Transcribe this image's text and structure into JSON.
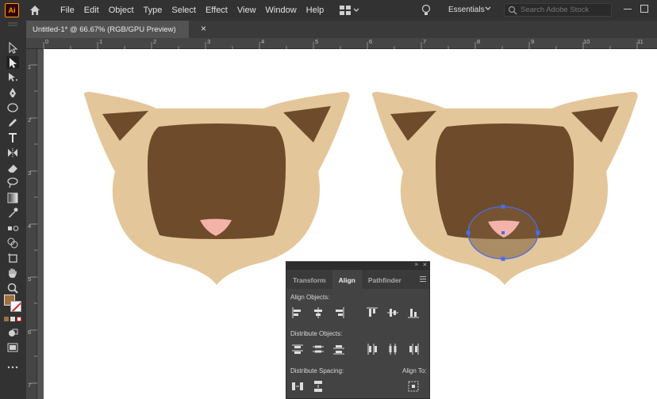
{
  "app": {
    "logo_text": "Ai",
    "menu": [
      "File",
      "Edit",
      "Object",
      "Type",
      "Select",
      "Effect",
      "View",
      "Window",
      "Help"
    ],
    "workspace": "Essentials",
    "search_placeholder": "Search Adobe Stock"
  },
  "document": {
    "tab_title": "Untitled-1* @ 66.67% (RGB/GPU Preview)"
  },
  "rulers": {
    "top": [
      "0",
      "1",
      "2",
      "3",
      "4",
      "5",
      "6",
      "7",
      "8",
      "9",
      "10",
      "11"
    ],
    "left": [
      "1",
      "2",
      "3",
      "4",
      "5",
      "6",
      "7"
    ]
  },
  "colors": {
    "accent": "#ff9a00",
    "cat_face": "#e3c79a",
    "cat_inner": "#6e4b2a",
    "cat_nose": "#f4b3a8",
    "selection": "#4a6cf0",
    "fill_swatch": "#a0703e"
  },
  "align_panel": {
    "tabs": [
      "Transform",
      "Align",
      "Pathfinder"
    ],
    "active_tab": "Align",
    "align_objects_label": "Align Objects:",
    "distribute_objects_label": "Distribute Objects:",
    "distribute_spacing_label": "Distribute Spacing:",
    "align_to_label": "Align To:"
  },
  "tools": [
    "selection-tool-icon",
    "direct-selection-tool-icon",
    "group-selection-tool-icon",
    "pen-tool-icon",
    "ellipse-tool-icon",
    "pencil-tool-icon",
    "type-tool-icon",
    "reflect-tool-icon",
    "eraser-tool-icon",
    "lasso-tool-icon",
    "gradient-tool-icon",
    "eyedropper-tool-icon",
    "blend-tool-icon",
    "shape-builder-tool-icon",
    "artboard-tool-icon",
    "hand-tool-icon",
    "zoom-tool-icon"
  ]
}
